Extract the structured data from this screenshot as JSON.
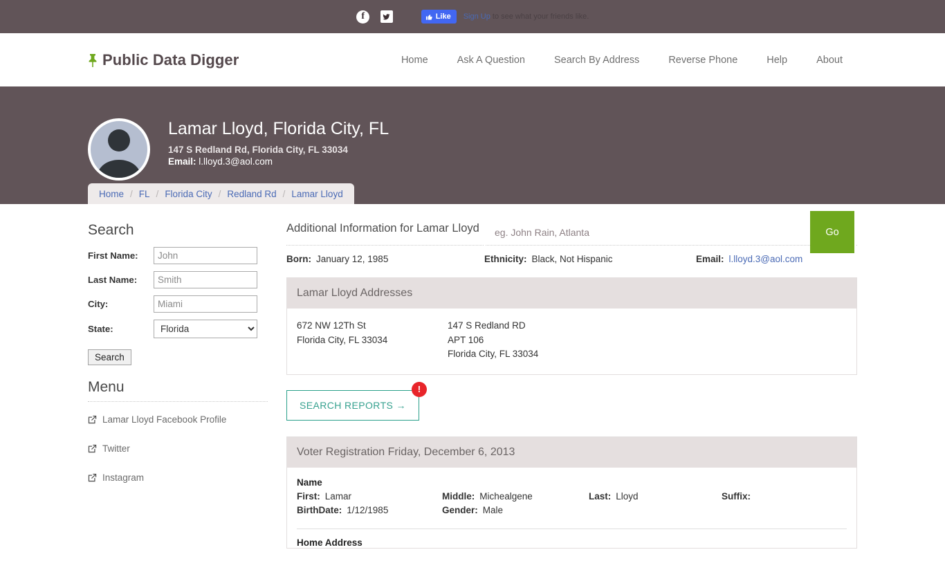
{
  "topbar": {
    "facebook_icon_label": "facebook-icon",
    "twitter_icon_label": "twitter-icon",
    "like_label": "Like",
    "signup_label": "Sign Up",
    "social_text": "to see what your friends like."
  },
  "header": {
    "brand": "Public Data Digger",
    "nav": [
      {
        "label": "Home"
      },
      {
        "label": "Ask A Question"
      },
      {
        "label": "Search By Address"
      },
      {
        "label": "Reverse Phone"
      },
      {
        "label": "Help"
      },
      {
        "label": "About"
      }
    ]
  },
  "hero": {
    "title": "Lamar Lloyd, Florida City, FL",
    "address": "147 S Redland Rd, Florida City, FL 33034",
    "email_label": "Email:",
    "email_value": "l.lloyd.3@aol.com",
    "search_placeholder": "eg. John Rain, Atlanta",
    "search_value": "",
    "go_label": "Go"
  },
  "breadcrumb": {
    "separator": "/",
    "items": [
      {
        "label": "Home"
      },
      {
        "label": "FL"
      },
      {
        "label": "Florida City"
      },
      {
        "label": "Redland Rd"
      },
      {
        "label": "Lamar Lloyd"
      }
    ]
  },
  "sidebar": {
    "search_heading": "Search",
    "fields": [
      {
        "label": "First Name:",
        "placeholder": "John",
        "value": ""
      },
      {
        "label": "Last Name:",
        "placeholder": "Smith",
        "value": ""
      },
      {
        "label": "City:",
        "placeholder": "Miami",
        "value": ""
      }
    ],
    "state_label": "State:",
    "state_value": "Florida",
    "state_options": [
      "Florida"
    ],
    "submit_label": "Search",
    "menu_heading": "Menu",
    "menu_items": [
      {
        "label": "Lamar Lloyd Facebook Profile",
        "icon": "external-link-icon"
      },
      {
        "label": "Twitter",
        "icon": "external-link-icon"
      },
      {
        "label": "Instagram",
        "icon": "external-link-icon"
      }
    ]
  },
  "content": {
    "heading": "Additional Information for Lamar Lloyd",
    "facts": [
      {
        "label": "Born:",
        "value": "January 12, 1985"
      },
      {
        "label": "Ethnicity:",
        "value": "Black, Not Hispanic"
      },
      {
        "label": "Email:",
        "value": "l.lloyd.3@aol.com"
      }
    ],
    "addresses_panel": {
      "title": "Lamar Lloyd Addresses",
      "columns": [
        [
          "672 NW 12Th St",
          "Florida City, FL 33034"
        ],
        [
          "147 S Redland RD",
          "APT 106",
          "Florida City, FL 33034"
        ]
      ]
    },
    "reports_button": {
      "label": "SEARCH REPORTS →",
      "badge": "!"
    },
    "voter_panel": {
      "title": "Voter Registration Friday, December 6, 2013",
      "name_heading": "Name",
      "row1": [
        {
          "label": "First:",
          "value": "Lamar"
        },
        {
          "label": "Middle:",
          "value": "Michealgene"
        },
        {
          "label": "Last:",
          "value": "Lloyd"
        },
        {
          "label": "Suffix:",
          "value": ""
        }
      ],
      "row2": [
        {
          "label": "BirthDate:",
          "value": "1/12/1985"
        },
        {
          "label": "Gender:",
          "value": "Male"
        }
      ],
      "next_section": "Home Address"
    }
  },
  "colors": {
    "hero_bg": "#615458",
    "accent_green": "#6fa81e",
    "link_blue": "#4a6ab5",
    "badge_red": "#e8252a",
    "teal": "#36a18f"
  }
}
